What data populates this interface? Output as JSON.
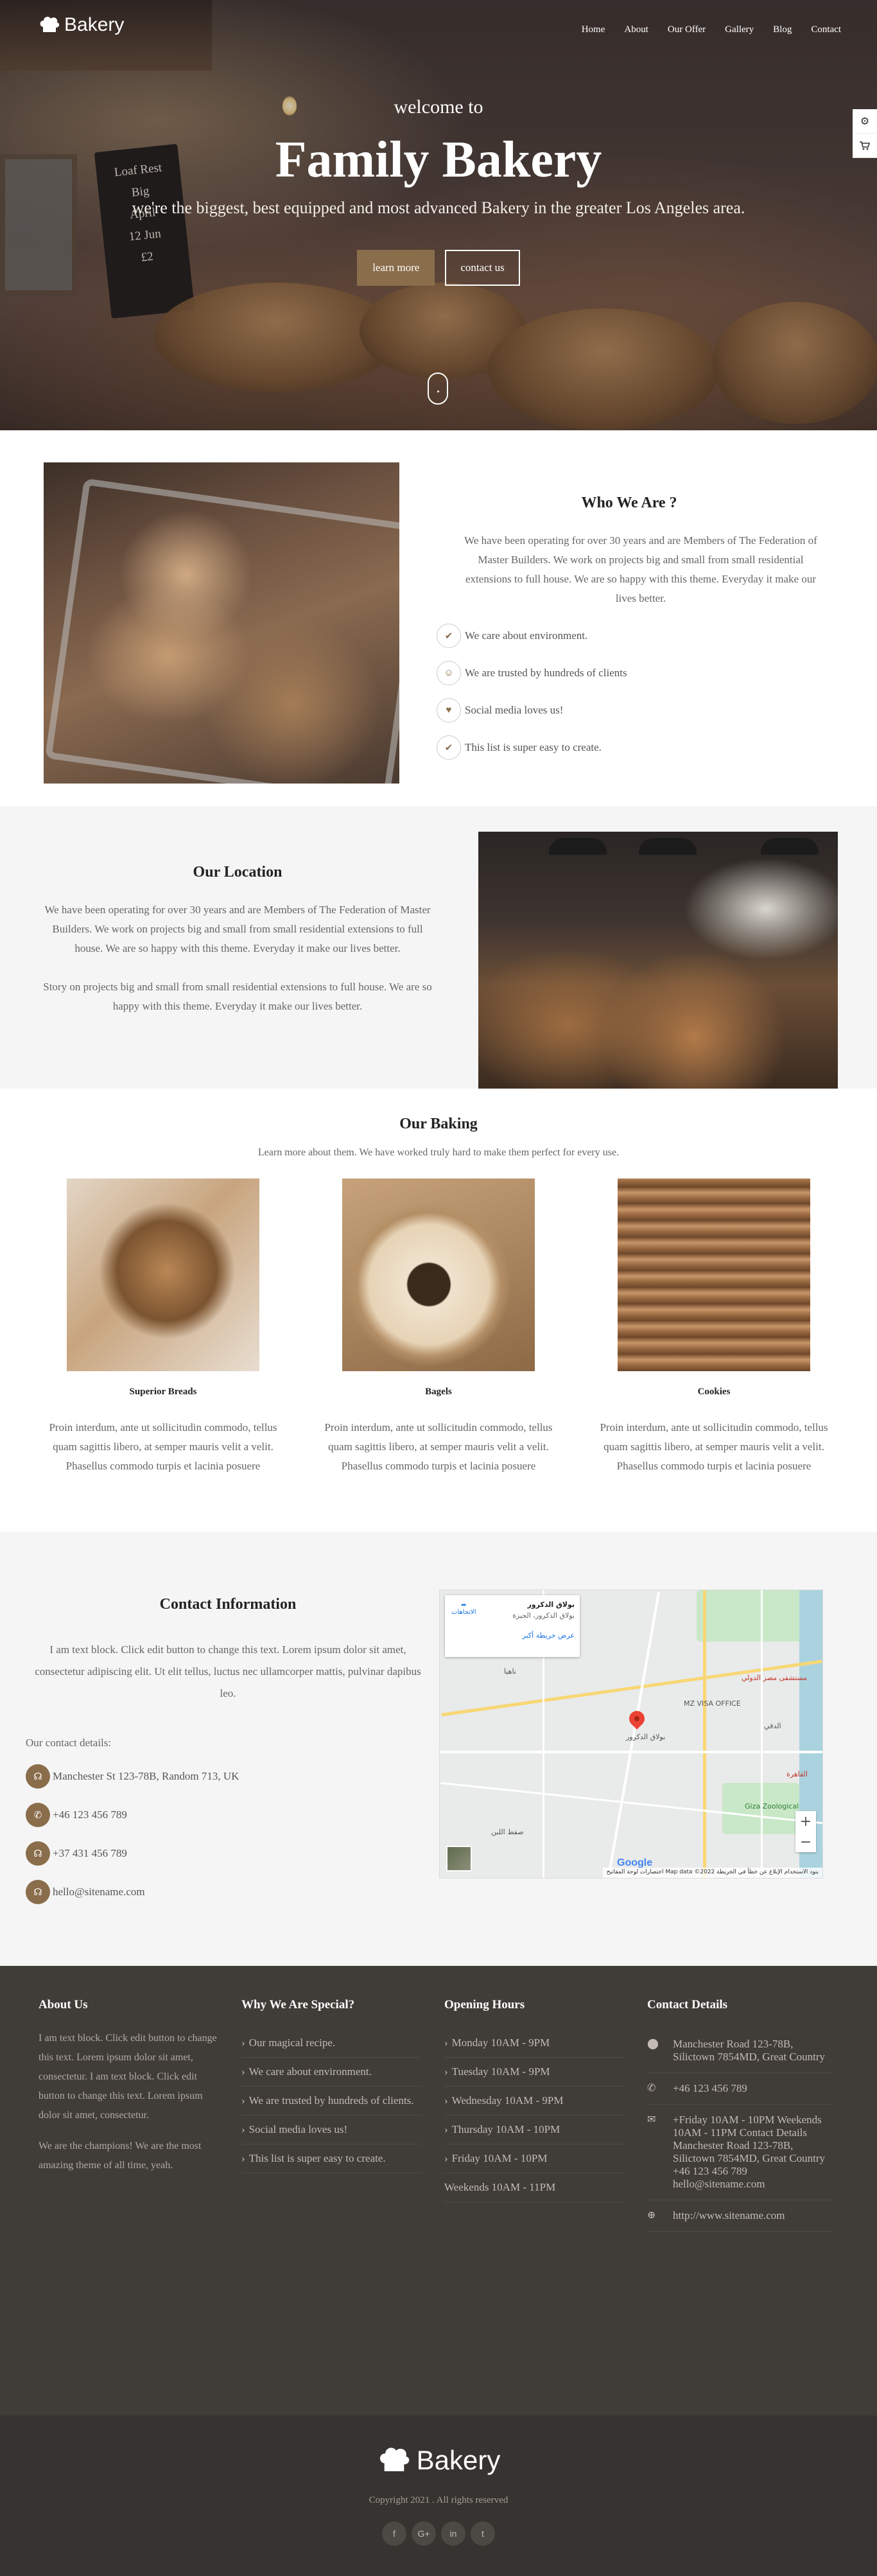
{
  "brand": {
    "name": "Bakery"
  },
  "nav": {
    "items": [
      "Home",
      "About",
      "Our Offer",
      "Gallery",
      "Blog",
      "Contact"
    ]
  },
  "side_tools": {
    "icons": [
      "gear-icon",
      "cart-icon"
    ]
  },
  "hero": {
    "welcome": "welcome to",
    "title": "Family Bakery",
    "subtitle": "we're the biggest, best equipped and most advanced Bakery in the greater Los Angeles area.",
    "btn_primary": "learn more",
    "btn_secondary": "contact us",
    "chalk_lines": [
      "Loaf Rest",
      "Big",
      "April",
      "12 Jun",
      "£2"
    ]
  },
  "who": {
    "title": "Who We Are ?",
    "text": "We have been operating for over 30 years and are Members of The Federation of Master Builders. We work on projects big and small from small residential extensions to full house. We are so happy with this theme. Everyday it make our lives better.",
    "features": [
      {
        "icon": "check-icon",
        "glyph": "✔",
        "label": "We care about environment."
      },
      {
        "icon": "users-icon",
        "glyph": "☺",
        "label": "We are trusted by hundreds of clients"
      },
      {
        "icon": "heart-icon",
        "glyph": "♥",
        "label": "Social media loves us!"
      },
      {
        "icon": "check-icon",
        "glyph": "✔",
        "label": "This list is super easy to create."
      }
    ]
  },
  "location": {
    "title": "Our Location",
    "p1": "We have been operating for over 30 years and are Members of The Federation of Master Builders. We work on projects big and small from small residential extensions to full house. We are so happy with this theme. Everyday it make our lives better.",
    "p2": "Story on projects big and small from small residential extensions to full house. We are so happy with this theme. Everyday it make our lives better."
  },
  "baking": {
    "title": "Our Baking",
    "subtitle": "Learn more about them. We have worked truly hard to make them perfect for every use.",
    "items": [
      {
        "name": "Superior Breads",
        "text": "Proin interdum, ante ut sollicitudin commodo, tellus quam sagittis libero, at semper mauris velit a velit. Phasellus commodo turpis et lacinia posuere"
      },
      {
        "name": "Bagels",
        "text": "Proin interdum, ante ut sollicitudin commodo, tellus quam sagittis libero, at semper mauris velit a velit. Phasellus commodo turpis et lacinia posuere"
      },
      {
        "name": "Cookies",
        "text": "Proin interdum, ante ut sollicitudin commodo, tellus quam sagittis libero, at semper mauris velit a velit. Phasellus commodo turpis et lacinia posuere"
      }
    ]
  },
  "contact": {
    "title": "Contact Information",
    "text": "I am text block. Click edit button to change this text. Lorem ipsum dolor sit amet, consectetur adipiscing elit. Ut elit tellus, luctus nec ullamcorper mattis, pulvinar dapibus leo.",
    "details_label": "Our contact details:",
    "items": [
      {
        "icon": "headset-icon",
        "glyph": "☊",
        "label": "Manchester St 123-78B, Random 713, UK"
      },
      {
        "icon": "phone-icon",
        "glyph": "✆",
        "label": "+46 123 456 789"
      },
      {
        "icon": "headset-icon",
        "glyph": "☊",
        "label": "+37 431 456 789"
      },
      {
        "icon": "headset-icon",
        "glyph": "☊",
        "label": "hello@sitename.com"
      }
    ],
    "map": {
      "place_title": "بولاق الدكرور",
      "place_sub": "بولاق الدكرور، الجيزة",
      "larger_map": "عرض خريطة أكبر",
      "directions": "الاتجاهات",
      "labels": [
        "بولاق الدكرور",
        "MZ VISA OFFICE",
        "الدقي",
        "Giza Zoological",
        "مستشفى مصر الدولي",
        "القاهرة",
        "ناهيا",
        "صفط اللبن"
      ],
      "footer": "Map data ©2022  بنود الاستخدام  الإبلاغ عن خطأ في الخريطة",
      "shortcuts": "اختصارات لوحة المفاتيح",
      "zoom_in": "+",
      "zoom_out": "−",
      "google": "Google"
    }
  },
  "footer": {
    "about": {
      "title": "About Us",
      "p1": "I am text block. Click edit button to change this text. Lorem ipsum dolor sit amet, consectetur. I am text block. Click edit button to change this text. Lorem ipsum dolor sit amet, consectetur.",
      "p2": "We are the champions! We are the most amazing theme of all time, yeah."
    },
    "special": {
      "title": "Why We Are Special?",
      "items": [
        "Our magical recipe.",
        "We care about environment.",
        "We are trusted by hundreds of clients.",
        "Social media loves us!",
        "This list is super easy to create."
      ]
    },
    "hours": {
      "title": "Opening Hours",
      "items": [
        "Monday 10AM - 9PM",
        "Tuesday 10AM - 9PM",
        "Wednesday 10AM - 9PM",
        "Thursday 10AM - 10PM",
        "Friday 10AM - 10PM"
      ],
      "weekends": "Weekends 10AM - 11PM"
    },
    "details": {
      "title": "Contact Details",
      "address": "Manchester Road 123-78B, Silictown 7854MD, Great Country",
      "phone": "+46 123 456 789",
      "long": "+Friday 10AM - 10PM Weekends 10AM - 11PM Contact Details Manchester Road 123-78B, Silictown 7854MD, Great Country +46 123 456 789 hello@sitename.com",
      "site": "http://www.sitename.com"
    }
  },
  "bottom": {
    "copyright": "Copyright 2021 . All rights reserved",
    "social": [
      "f",
      "G+",
      "in",
      "t"
    ]
  },
  "colors": {
    "accent": "#8a6d4b",
    "footer_bg": "#403c37",
    "bottom_bg": "#363330",
    "section_alt": "#f5f5f5"
  }
}
